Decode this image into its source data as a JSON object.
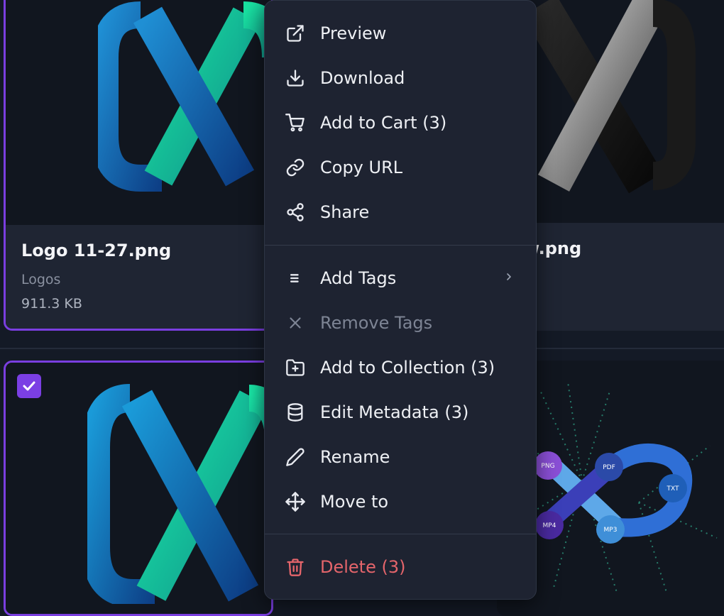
{
  "cards": [
    {
      "name": "Logo 11-27.png",
      "folder": "Logos",
      "size": "911.3 KB",
      "selected": true
    },
    {
      "name": "w.png",
      "folder": "",
      "size": "",
      "selected": false
    },
    {
      "name": "",
      "selected": true
    },
    {
      "name": "",
      "selected": false
    }
  ],
  "badges": [
    "PNG",
    "PDF",
    "TXT",
    "MP3",
    "MP4"
  ],
  "menu": {
    "items": [
      {
        "label": "Preview",
        "icon": "external-link-icon"
      },
      {
        "label": "Download",
        "icon": "download-icon"
      },
      {
        "label": "Add to Cart (3)",
        "icon": "cart-icon"
      },
      {
        "label": "Copy URL",
        "icon": "link-icon"
      },
      {
        "label": "Share",
        "icon": "share-icon"
      },
      {
        "label": "Add Tags",
        "icon": "list-icon",
        "submenu": true
      },
      {
        "label": "Remove Tags",
        "icon": "close-icon",
        "disabled": true
      },
      {
        "label": "Add to Collection (3)",
        "icon": "folder-plus-icon"
      },
      {
        "label": "Edit Metadata (3)",
        "icon": "database-icon"
      },
      {
        "label": "Rename",
        "icon": "pencil-icon"
      },
      {
        "label": "Move to",
        "icon": "move-icon"
      },
      {
        "label": "Delete (3)",
        "icon": "trash-icon",
        "danger": true
      }
    ]
  },
  "colors": {
    "accent": "#7b3fe4",
    "danger": "#e5656b",
    "menu_bg": "#1e2331"
  }
}
